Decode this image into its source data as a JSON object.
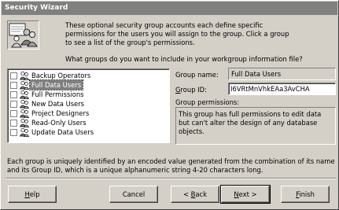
{
  "window": {
    "title": "Security Wizard"
  },
  "header": {
    "intro": "These optional security group accounts each define specific permissions for the users you will assign to the group. Click a group to see a list of the group's permissions.",
    "question": "What groups do you want to include in your workgroup information file?"
  },
  "groups": {
    "items": [
      {
        "label": "Backup Operators",
        "checked": false,
        "selected": false
      },
      {
        "label": "Full Data Users",
        "checked": false,
        "selected": true
      },
      {
        "label": "Full Permissions",
        "checked": false,
        "selected": false
      },
      {
        "label": "New Data Users",
        "checked": false,
        "selected": false
      },
      {
        "label": "Project Designers",
        "checked": false,
        "selected": false
      },
      {
        "label": "Read-Only Users",
        "checked": false,
        "selected": false
      },
      {
        "label": "Update Data Users",
        "checked": false,
        "selected": false
      }
    ]
  },
  "details": {
    "group_name_label": "Group name:",
    "group_name_value": "Full Data Users",
    "group_id_label": "Group ID:",
    "group_id_value": "I6VRtMnVhkEAa3AvCHA",
    "permissions_label": "Group permissions:",
    "permissions_text": "This group has full permissions to edit data but can't alter the design of any database objects."
  },
  "footer": {
    "note": "Each group is uniquely identified by an encoded value generated from the combination of its name and its Group ID, which is a unique alphanumeric string 4-20 characters long."
  },
  "buttons": {
    "help": "Help",
    "cancel": "Cancel",
    "back": "< Back",
    "next": "Next >",
    "finish": "Finish"
  },
  "colors": {
    "face": "#d4d0c8",
    "title_bar": "#808080",
    "selection": "#808080"
  }
}
